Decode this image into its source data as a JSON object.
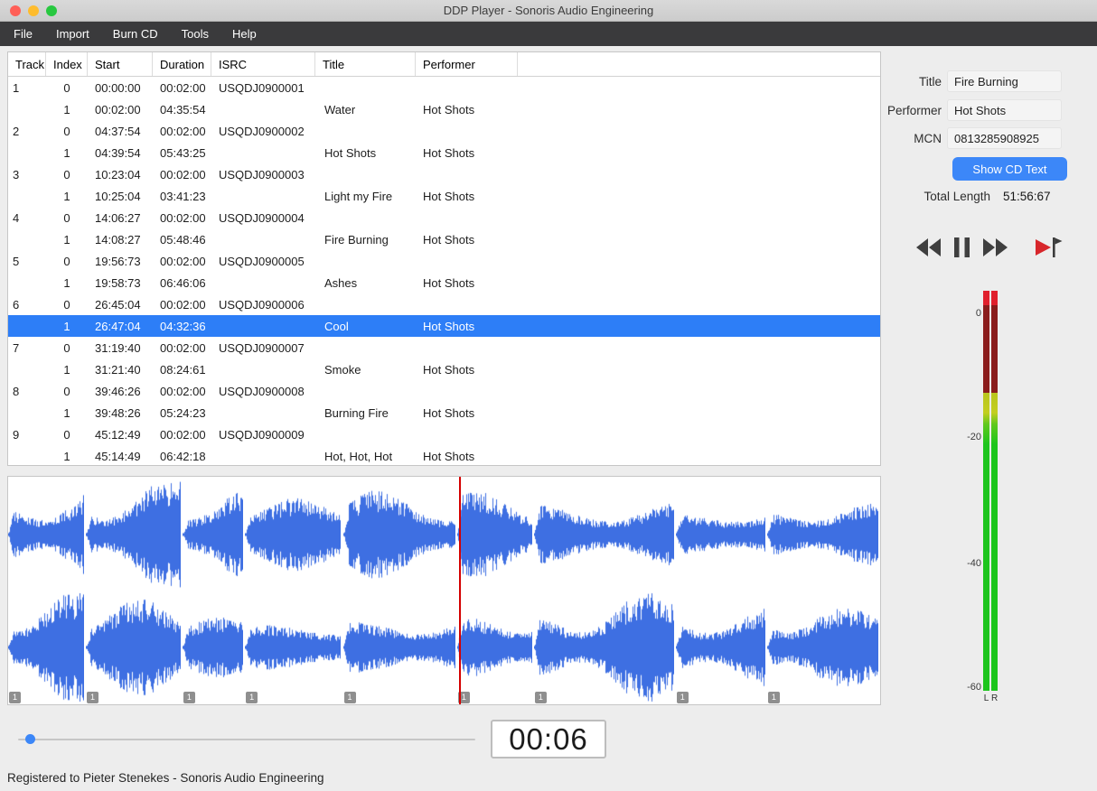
{
  "window": {
    "title": "DDP Player - Sonoris Audio Engineering",
    "menu": [
      "File",
      "Import",
      "Burn CD",
      "Tools",
      "Help"
    ],
    "status": "Registered to Pieter Stenekes - Sonoris Audio Engineering"
  },
  "colors": {
    "accent": "#3c87f8",
    "selection": "#2d7ef7",
    "waveform": "#3e6fe2",
    "playhead": "#d40000"
  },
  "table": {
    "columns": [
      "Track",
      "Index",
      "Start",
      "Duration",
      "ISRC",
      "Title",
      "Performer"
    ],
    "rows": [
      {
        "track": "1",
        "index": "0",
        "start": "00:00:00",
        "duration": "00:02:00",
        "isrc": "USQDJ0900001",
        "title": "",
        "performer": ""
      },
      {
        "track": "",
        "index": "1",
        "start": "00:02:00",
        "duration": "04:35:54",
        "isrc": "",
        "title": "Water",
        "performer": "Hot Shots"
      },
      {
        "track": "2",
        "index": "0",
        "start": "04:37:54",
        "duration": "00:02:00",
        "isrc": "USQDJ0900002",
        "title": "",
        "performer": ""
      },
      {
        "track": "",
        "index": "1",
        "start": "04:39:54",
        "duration": "05:43:25",
        "isrc": "",
        "title": "Hot Shots",
        "performer": "Hot Shots"
      },
      {
        "track": "3",
        "index": "0",
        "start": "10:23:04",
        "duration": "00:02:00",
        "isrc": "USQDJ0900003",
        "title": "",
        "performer": ""
      },
      {
        "track": "",
        "index": "1",
        "start": "10:25:04",
        "duration": "03:41:23",
        "isrc": "",
        "title": "Light my Fire",
        "performer": "Hot Shots"
      },
      {
        "track": "4",
        "index": "0",
        "start": "14:06:27",
        "duration": "00:02:00",
        "isrc": "USQDJ0900004",
        "title": "",
        "performer": ""
      },
      {
        "track": "",
        "index": "1",
        "start": "14:08:27",
        "duration": "05:48:46",
        "isrc": "",
        "title": "Fire Burning",
        "performer": "Hot Shots"
      },
      {
        "track": "5",
        "index": "0",
        "start": "19:56:73",
        "duration": "00:02:00",
        "isrc": "USQDJ0900005",
        "title": "",
        "performer": ""
      },
      {
        "track": "",
        "index": "1",
        "start": "19:58:73",
        "duration": "06:46:06",
        "isrc": "",
        "title": "Ashes",
        "performer": "Hot Shots"
      },
      {
        "track": "6",
        "index": "0",
        "start": "26:45:04",
        "duration": "00:02:00",
        "isrc": "USQDJ0900006",
        "title": "",
        "performer": ""
      },
      {
        "track": "",
        "index": "1",
        "start": "26:47:04",
        "duration": "04:32:36",
        "isrc": "",
        "title": "Cool",
        "performer": "Hot Shots",
        "selected": true
      },
      {
        "track": "7",
        "index": "0",
        "start": "31:19:40",
        "duration": "00:02:00",
        "isrc": "USQDJ0900007",
        "title": "",
        "performer": ""
      },
      {
        "track": "",
        "index": "1",
        "start": "31:21:40",
        "duration": "08:24:61",
        "isrc": "",
        "title": "Smoke",
        "performer": "Hot Shots"
      },
      {
        "track": "8",
        "index": "0",
        "start": "39:46:26",
        "duration": "00:02:00",
        "isrc": "USQDJ0900008",
        "title": "",
        "performer": ""
      },
      {
        "track": "",
        "index": "1",
        "start": "39:48:26",
        "duration": "05:24:23",
        "isrc": "",
        "title": "Burning Fire",
        "performer": "Hot Shots"
      },
      {
        "track": "9",
        "index": "0",
        "start": "45:12:49",
        "duration": "00:02:00",
        "isrc": "USQDJ0900009",
        "title": "",
        "performer": ""
      },
      {
        "track": "",
        "index": "1",
        "start": "45:14:49",
        "duration": "06:42:18",
        "isrc": "",
        "title": "Hot, Hot, Hot",
        "performer": "Hot Shots"
      }
    ]
  },
  "inspector": {
    "title_label": "Title",
    "title_value": "Fire Burning",
    "performer_label": "Performer",
    "performer_value": "Hot Shots",
    "mcn_label": "MCN",
    "mcn_value": "0813285908925",
    "show_cd_text_label": "Show CD Text",
    "total_length_label": "Total Length",
    "total_length_value": "51:56:67"
  },
  "meter": {
    "scale": [
      "0",
      "-20",
      "-40",
      "-60"
    ],
    "left_label": "L",
    "right_label": "R"
  },
  "transport": {
    "time": "00:06",
    "slider_frac": 0.025,
    "icons": [
      "rewind-icon",
      "pause-icon",
      "fast-forward-icon",
      "next-marker-icon"
    ]
  },
  "waveform": {
    "playhead_frac": 0.517,
    "segments": [
      {
        "marker": "1",
        "frac": 0.0891
      },
      {
        "marker": "1",
        "frac": 0.1108
      },
      {
        "marker": "1",
        "frac": 0.0717
      },
      {
        "marker": "1",
        "frac": 0.1124
      },
      {
        "marker": "1",
        "frac": 0.1309
      },
      {
        "marker": "1",
        "frac": 0.0881
      },
      {
        "marker": "1",
        "frac": 0.1626
      },
      {
        "marker": "1",
        "frac": 0.1047
      },
      {
        "marker": "1",
        "frac": 0.1297
      }
    ]
  }
}
